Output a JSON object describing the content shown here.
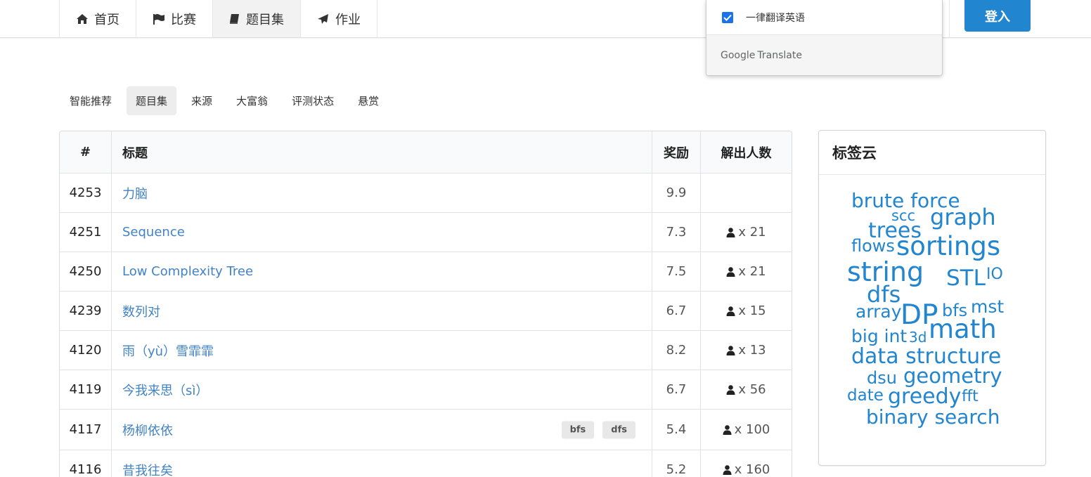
{
  "nav": {
    "items": [
      {
        "label": "首页",
        "icon": "home-icon"
      },
      {
        "label": "比赛",
        "icon": "flag-icon"
      },
      {
        "label": "题目集",
        "icon": "book-icon"
      },
      {
        "label": "作业",
        "icon": "plane-icon"
      }
    ],
    "login": "登入"
  },
  "translate": {
    "checkbox_label": "一律翻译英语",
    "checked": true,
    "brand_google": "Google",
    "brand_translate": "Translate"
  },
  "subnav": {
    "items": [
      "智能推荐",
      "题目集",
      "来源",
      "大富翁",
      "评测状态",
      "悬赏"
    ],
    "active": "题目集"
  },
  "table": {
    "headers": {
      "id": "#",
      "title": "标题",
      "reward": "奖励",
      "solved": "解出人数"
    },
    "rows": [
      {
        "id": "4253",
        "title": "力脑",
        "reward": "9.9",
        "solved": "",
        "tags": []
      },
      {
        "id": "4251",
        "title": "Sequence",
        "reward": "7.3",
        "solved": "x 21",
        "tags": []
      },
      {
        "id": "4250",
        "title": "Low Complexity Tree",
        "reward": "7.5",
        "solved": "x 21",
        "tags": []
      },
      {
        "id": "4239",
        "title": "数列对",
        "reward": "6.7",
        "solved": "x 15",
        "tags": []
      },
      {
        "id": "4120",
        "title": "雨（yù）雪霏霏",
        "reward": "8.2",
        "solved": "x 13",
        "tags": []
      },
      {
        "id": "4119",
        "title": "今我来思（sì）",
        "reward": "6.7",
        "solved": "x 56",
        "tags": []
      },
      {
        "id": "4117",
        "title": "杨柳依依",
        "reward": "5.4",
        "solved": "x 100",
        "tags": [
          "bfs",
          "dfs"
        ]
      },
      {
        "id": "4116",
        "title": "昔我往矣",
        "reward": "5.2",
        "solved": "x 160",
        "tags": []
      }
    ]
  },
  "tag_cloud": {
    "title": "标签云",
    "words": [
      "brute force",
      "scc",
      "graph",
      "trees",
      "flows",
      "sortings",
      "string",
      "STL",
      "IO",
      "dfs",
      "array",
      "DP",
      "bfs",
      "mst",
      "math",
      "big int",
      "3d",
      "data structure",
      "dsu",
      "geometry",
      "date",
      "greedy",
      "fft",
      "binary search"
    ]
  },
  "colors": {
    "accent": "#2185d0",
    "link": "#4183c4",
    "google_blue": "#1a73e8"
  }
}
